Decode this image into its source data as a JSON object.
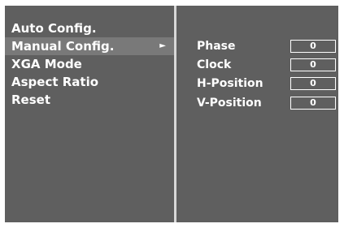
{
  "menu": {
    "items": [
      {
        "label": "Auto Config."
      },
      {
        "label": "Manual Config.",
        "arrow": "►"
      },
      {
        "label": "XGA Mode"
      },
      {
        "label": "Aspect Ratio"
      },
      {
        "label": "Reset"
      }
    ]
  },
  "params": {
    "rows": [
      {
        "label": "Phase",
        "value": "0"
      },
      {
        "label": "Clock",
        "value": "0"
      },
      {
        "label": "H-Position",
        "value": "0"
      },
      {
        "label": "V-Position",
        "value": "0"
      }
    ]
  },
  "colors": {
    "panel_background": "#5f5f5f",
    "selected_background": "#797979",
    "text": "#ffffff",
    "divider": "#d8d8d8"
  }
}
